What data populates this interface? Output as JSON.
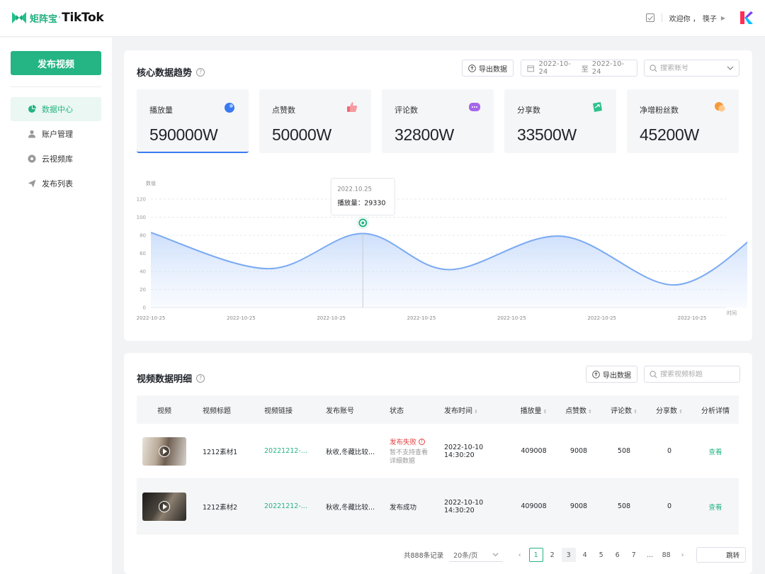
{
  "header": {
    "logo_cn": "矩阵宝",
    "logo_dot": "·",
    "logo_brand": "TikTok",
    "welcome": "欢迎你 ，",
    "user": "筷子"
  },
  "sidebar": {
    "publish_label": "发布视频",
    "items": [
      {
        "label": "数据中心",
        "icon": "pie-chart-icon",
        "active": true
      },
      {
        "label": "账户管理",
        "icon": "user-icon",
        "active": false
      },
      {
        "label": "云视频库",
        "icon": "video-library-icon",
        "active": false
      },
      {
        "label": "发布列表",
        "icon": "send-icon",
        "active": false
      }
    ]
  },
  "trend": {
    "title": "核心数据趋势",
    "help": "?",
    "export_label": "导出数据",
    "date_from": "2022-10-24",
    "date_sep": "至",
    "date_to": "2022-10-24",
    "account_placeholder": "搜索账号",
    "stats": [
      {
        "label": "播放量",
        "value": "590000W",
        "color": "#3a7af0",
        "icon": "play-stat-icon"
      },
      {
        "label": "点赞数",
        "value": "50000W",
        "color": "#ef6b74",
        "icon": "thumbs-up-icon"
      },
      {
        "label": "评论数",
        "value": "32800W",
        "color": "#a766e9",
        "icon": "comment-icon"
      },
      {
        "label": "分享数",
        "value": "33500W",
        "color": "#2fc18e",
        "icon": "share-icon"
      },
      {
        "label": "净增粉丝数",
        "value": "45200W",
        "color": "#f59a3c",
        "icon": "fans-icon"
      }
    ]
  },
  "chart_data": {
    "type": "area",
    "ylabel": "数值",
    "xlabel": "时间",
    "ylim": [
      0,
      120
    ],
    "yticks": [
      "0",
      "20",
      "40",
      "60",
      "80",
      "100",
      "120"
    ],
    "categories": [
      "2022-10-25",
      "2022-10-25",
      "2022-10-25",
      "2022-10-25",
      "2022-10-25",
      "2022-10-25",
      "2022-10-25"
    ],
    "curve_x": [
      0,
      1.3,
      2.35,
      3.3,
      4.55,
      5.8,
      6.75
    ],
    "curve_y": [
      83,
      43,
      82,
      42,
      79,
      25,
      83
    ],
    "color": "#7aaaf3",
    "tooltip": {
      "date": "2022.10.25",
      "label": "播放量：",
      "value": "29330",
      "x": 2.35
    }
  },
  "detail": {
    "title": "视频数据明细",
    "help": "?",
    "export_label": "导出数据",
    "search_placeholder": "搜索视频标题",
    "columns": [
      "视频",
      "视频标题",
      "视频链接",
      "发布账号",
      "状态",
      "发布时间",
      "播放量",
      "点赞数",
      "评论数",
      "分享数",
      "分析详情"
    ],
    "sortable": [
      "",
      "",
      "",
      "",
      "",
      "⇕",
      "⇕",
      "⇕",
      "⇕",
      "⇕",
      ""
    ],
    "rows": [
      {
        "title": "1212素材1",
        "link": "20221212-...",
        "account": "秋收,冬藏比较...",
        "status": "发布失败",
        "status_note": "暂不支持查看详细数据",
        "time": "2022-10-10 14:30:20",
        "plays": "409008",
        "likes": "9008",
        "comments": "508",
        "shares": "0",
        "action": "查看"
      },
      {
        "title": "1212素材2",
        "link": "20221212-...",
        "account": "秋收,冬藏比较...",
        "status": "发布成功",
        "status_note": "",
        "time": "2022-10-10 14:30:20",
        "plays": "409008",
        "likes": "9008",
        "comments": "508",
        "shares": "0",
        "action": "查看"
      }
    ]
  },
  "pagination": {
    "total": "共888条记录",
    "page_size": "20条/页",
    "pages": [
      "1",
      "2",
      "3",
      "4",
      "5",
      "6",
      "7",
      "...",
      "88"
    ],
    "current": "1",
    "jump_label": "跳转"
  }
}
